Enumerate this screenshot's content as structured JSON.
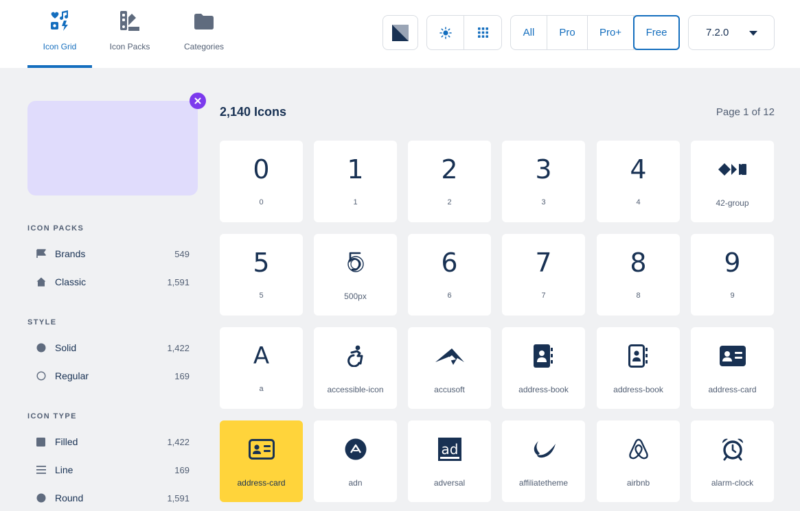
{
  "nav": {
    "tabs": [
      {
        "label": "Icon Grid",
        "icon": "shapes-icon",
        "active": true
      },
      {
        "label": "Icon Packs",
        "icon": "swatchbook-icon",
        "active": false
      },
      {
        "label": "Categories",
        "icon": "folder-icon",
        "active": false
      }
    ]
  },
  "toolbar": {
    "theme_icon": "contrast-icon",
    "view_icons": [
      "sun-icon",
      "grid-icon"
    ],
    "filters": [
      "All",
      "Pro",
      "Pro+",
      "Free"
    ],
    "selected_filter": "Free",
    "version": "7.2.0"
  },
  "sidebar": {
    "sections": [
      {
        "title": "ICON PACKS",
        "items": [
          {
            "label": "Brands",
            "count": "549",
            "icon": "flag-icon"
          },
          {
            "label": "Classic",
            "count": "1,591",
            "icon": "house-icon"
          }
        ]
      },
      {
        "title": "STYLE",
        "items": [
          {
            "label": "Solid",
            "count": "1,422",
            "icon": "solid-circle-icon"
          },
          {
            "label": "Regular",
            "count": "169",
            "icon": "outline-circle-icon"
          }
        ]
      },
      {
        "title": "ICON TYPE",
        "items": [
          {
            "label": "Filled",
            "count": "1,422",
            "icon": "filled-square-icon"
          },
          {
            "label": "Line",
            "count": "169",
            "icon": "bars-icon"
          },
          {
            "label": "Round",
            "count": "1,591",
            "icon": "round-icon"
          }
        ]
      }
    ]
  },
  "main": {
    "title": "2,140 Icons",
    "page_info": "Page 1 of 12",
    "icons": [
      {
        "name": "0",
        "glyph": "0"
      },
      {
        "name": "1",
        "glyph": "1"
      },
      {
        "name": "2",
        "glyph": "2"
      },
      {
        "name": "3",
        "glyph": "3"
      },
      {
        "name": "4",
        "glyph": "4"
      },
      {
        "name": "42-group",
        "glyph": ""
      },
      {
        "name": "5",
        "glyph": "5"
      },
      {
        "name": "500px",
        "glyph": ""
      },
      {
        "name": "6",
        "glyph": "6"
      },
      {
        "name": "7",
        "glyph": "7"
      },
      {
        "name": "8",
        "glyph": "8"
      },
      {
        "name": "9",
        "glyph": "9"
      },
      {
        "name": "a",
        "glyph": "A"
      },
      {
        "name": "accessible-icon",
        "glyph": ""
      },
      {
        "name": "accusoft",
        "glyph": ""
      },
      {
        "name": "address-book",
        "glyph": ""
      },
      {
        "name": "address-book",
        "glyph": ""
      },
      {
        "name": "address-card",
        "glyph": ""
      },
      {
        "name": "address-card",
        "glyph": ""
      },
      {
        "name": "adn",
        "glyph": ""
      },
      {
        "name": "adversal",
        "glyph": "ad"
      },
      {
        "name": "affiliatetheme",
        "glyph": ""
      },
      {
        "name": "airbnb",
        "glyph": ""
      },
      {
        "name": "alarm-clock",
        "glyph": ""
      }
    ],
    "selected_index": 18
  },
  "colors": {
    "accent": "#146ebe",
    "navy": "#183153",
    "selected_tile": "#ffd43b",
    "preview_bg": "#e0dcfc",
    "close_button": "#7c3aed"
  }
}
